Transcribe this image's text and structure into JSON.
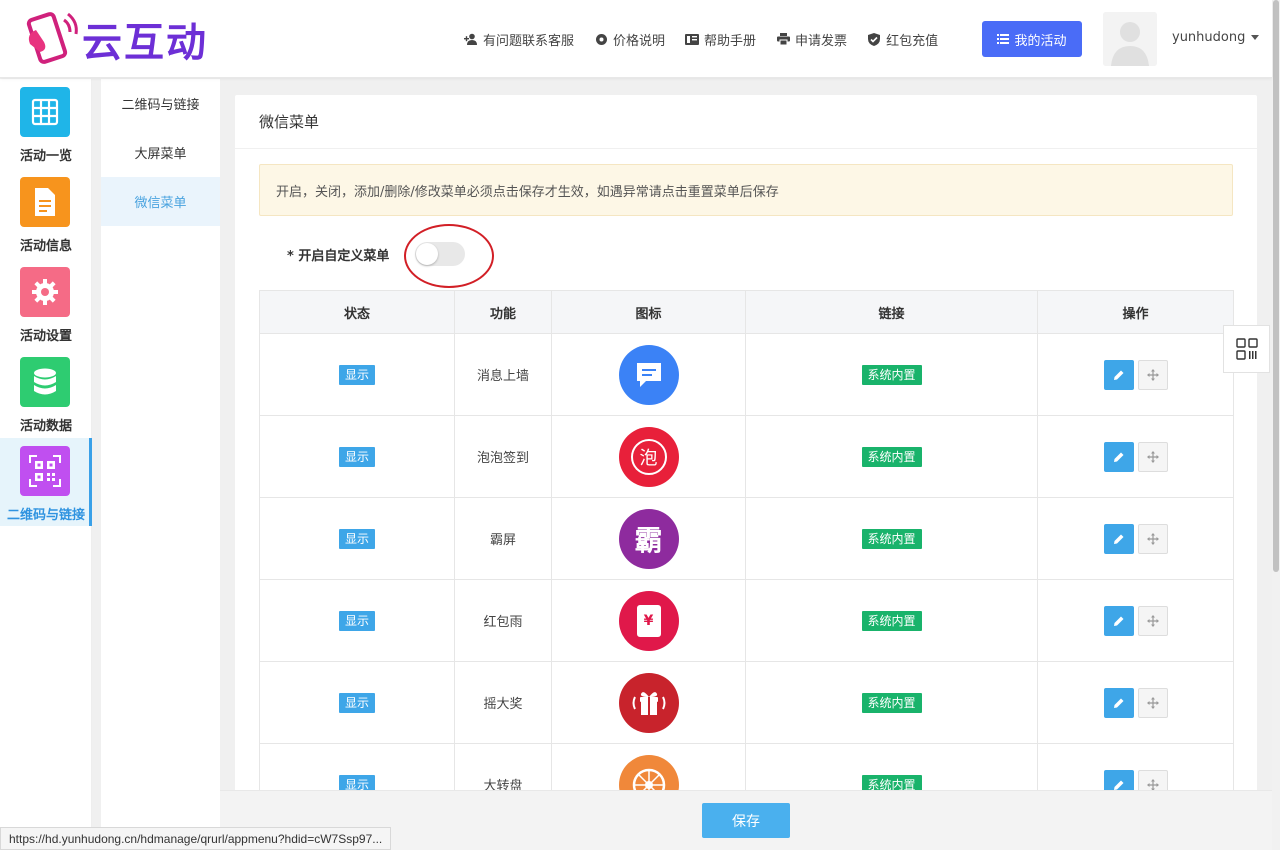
{
  "brand": {
    "name": "云互动"
  },
  "topnav": {
    "items": [
      {
        "label": "有问题联系客服",
        "icon": "person-add-icon"
      },
      {
        "label": "价格说明",
        "icon": "gear-icon"
      },
      {
        "label": "帮助手册",
        "icon": "book-icon"
      },
      {
        "label": "申请发票",
        "icon": "printer-icon"
      },
      {
        "label": "红包充值",
        "icon": "shield-check-icon"
      }
    ],
    "my_activity": "我的活动",
    "username": "yunhudong"
  },
  "sidebar": {
    "items": [
      {
        "label": "活动一览",
        "color": "#1fb5e8",
        "icon": "grid-icon"
      },
      {
        "label": "活动信息",
        "color": "#f7941d",
        "icon": "document-icon"
      },
      {
        "label": "活动设置",
        "color": "#f56b86",
        "icon": "gear-icon"
      },
      {
        "label": "活动数据",
        "color": "#2ecc71",
        "icon": "database-icon"
      },
      {
        "label": "二维码与链接",
        "color": "#c04ff0",
        "icon": "qrcode-icon"
      }
    ]
  },
  "submenu": {
    "items": [
      "二维码与链接",
      "大屏菜单",
      "微信菜单"
    ]
  },
  "main": {
    "title": "微信菜单",
    "notice": "开启，关闭，添加/删除/修改菜单必须点击保存才生效，如遇异常请点击重置菜单后保存",
    "toggle_label": "* 开启自定义菜单"
  },
  "table": {
    "headers": [
      "状态",
      "功能",
      "图标",
      "链接",
      "操作"
    ],
    "rows": [
      {
        "status": "显示",
        "func": "消息上墙",
        "icon_text": "",
        "icon": "chat-bubble-icon",
        "color": "#3b82f6",
        "link": "系统内置"
      },
      {
        "status": "显示",
        "func": "泡泡签到",
        "icon_text": "泡",
        "icon": "bubble-checkin-icon",
        "color": "#e8203a",
        "link": "系统内置"
      },
      {
        "status": "显示",
        "func": "霸屏",
        "icon_text": "霸",
        "icon": "bapin-icon",
        "color": "#8e2b9e",
        "link": "系统内置"
      },
      {
        "status": "显示",
        "func": "红包雨",
        "icon_text": "¥",
        "icon": "red-envelope-icon",
        "color": "#e0184a",
        "link": "系统内置"
      },
      {
        "status": "显示",
        "func": "摇大奖",
        "icon_text": "",
        "icon": "gift-shake-icon",
        "color": "#c8232c",
        "link": "系统内置"
      },
      {
        "status": "显示",
        "func": "大转盘",
        "icon_text": "",
        "icon": "wheel-icon",
        "color": "#f0883a",
        "link": "系统内置"
      }
    ]
  },
  "footer": {
    "save": "保存"
  },
  "statusbar": {
    "url": "https://hd.yunhudong.cn/hdmanage/qrurl/appmenu?hdid=cW7Ssp97..."
  }
}
